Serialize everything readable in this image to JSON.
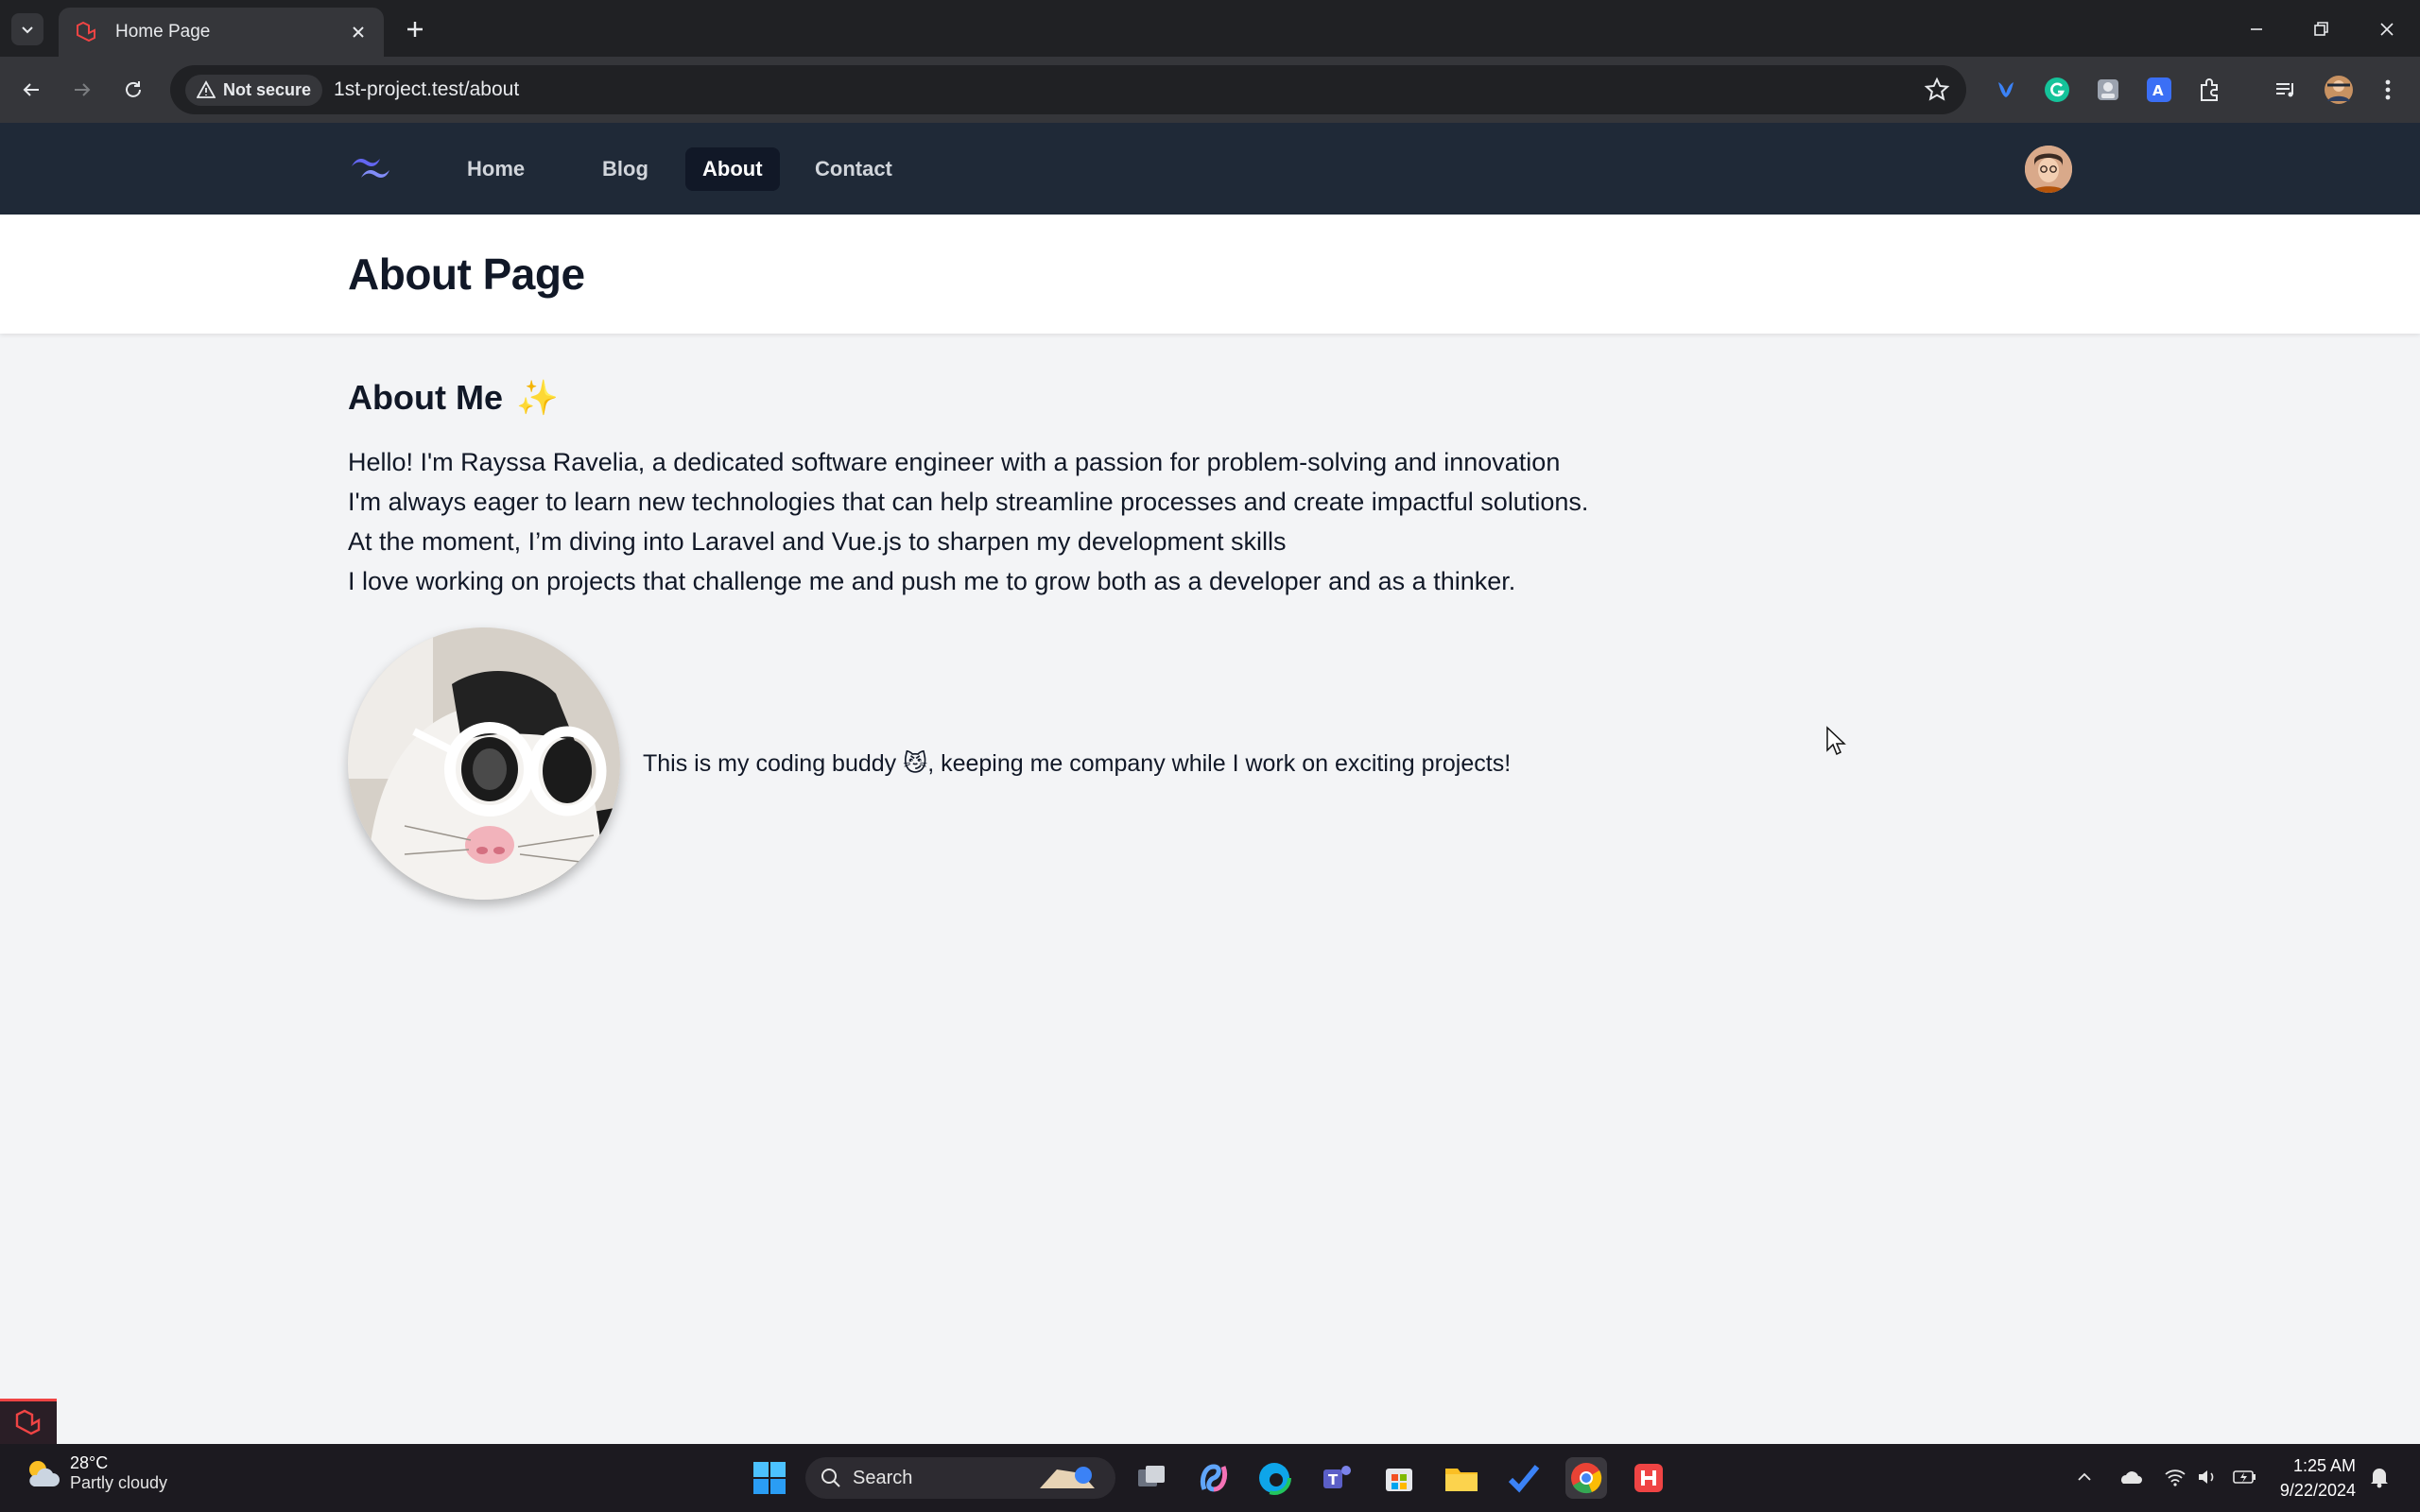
{
  "browser": {
    "tab_title": "Home Page",
    "security_label": "Not secure",
    "url": "1st-project.test/about"
  },
  "nav": {
    "links": [
      "Home",
      "Blog",
      "About",
      "Contact"
    ],
    "active": "About"
  },
  "header": {
    "title": "About Page"
  },
  "about": {
    "heading": "About Me",
    "heading_emoji": "✨",
    "paragraphs": [
      "Hello! I'm Rayssa Ravelia, a dedicated software engineer with a passion for problem-solving and innovation",
      "I'm always eager to learn new technologies that can help streamline processes and create impactful solutions.",
      "At the moment, I’m diving into Laravel and Vue.js to sharpen my development skills",
      "I love working on projects that challenge me and push me to grow both as a developer and as a thinker."
    ],
    "caption_before": "This is my coding buddy ",
    "caption_emoji": "😼",
    "caption_after": ", keeping me company while I work on exciting projects!"
  },
  "taskbar": {
    "weather_temp": "28°C",
    "weather_condition": "Partly cloudy",
    "search_label": "Search",
    "time": "1:25 AM",
    "date": "9/22/2024"
  },
  "colors": {
    "nav_bg": "#1f2937",
    "nav_active_bg": "#111827",
    "page_bg": "#f3f4f6",
    "logo_accent": "#6366f1"
  }
}
